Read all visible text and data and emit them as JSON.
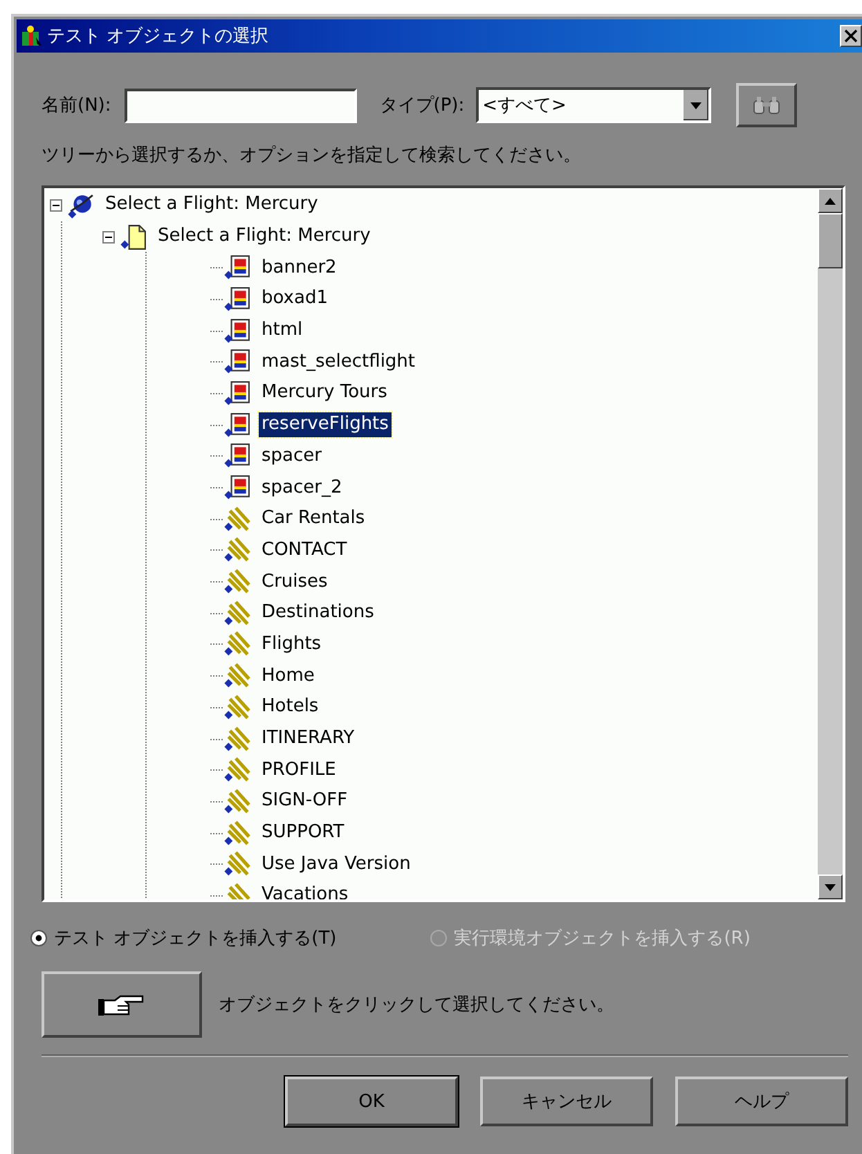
{
  "window": {
    "title": "テスト オブジェクトの選択"
  },
  "name_field": {
    "label": "名前(N):"
  },
  "type_field": {
    "label": "タイプ(P):",
    "value": "<すべて>"
  },
  "hint": "ツリーから選択するか、オプションを指定して検索してください。",
  "tree": [
    {
      "label": "Select a Flight: Mercury",
      "kind": "browser",
      "expanded": true,
      "selected": false,
      "children": [
        {
          "label": "Select a Flight: Mercury",
          "kind": "page",
          "expanded": true,
          "selected": false,
          "children": [
            {
              "label": "banner2",
              "kind": "image",
              "selected": false
            },
            {
              "label": "boxad1",
              "kind": "image",
              "selected": false
            },
            {
              "label": "html",
              "kind": "image",
              "selected": false
            },
            {
              "label": "mast_selectflight",
              "kind": "image",
              "selected": false
            },
            {
              "label": "Mercury Tours",
              "kind": "image",
              "selected": false
            },
            {
              "label": "reserveFlights",
              "kind": "image",
              "selected": true
            },
            {
              "label": "spacer",
              "kind": "image",
              "selected": false
            },
            {
              "label": "spacer_2",
              "kind": "image",
              "selected": false
            },
            {
              "label": "Car Rentals",
              "kind": "link",
              "selected": false
            },
            {
              "label": "CONTACT",
              "kind": "link",
              "selected": false
            },
            {
              "label": "Cruises",
              "kind": "link",
              "selected": false
            },
            {
              "label": "Destinations",
              "kind": "link",
              "selected": false
            },
            {
              "label": "Flights",
              "kind": "link",
              "selected": false
            },
            {
              "label": "Home",
              "kind": "link",
              "selected": false
            },
            {
              "label": "Hotels",
              "kind": "link",
              "selected": false
            },
            {
              "label": "ITINERARY",
              "kind": "link",
              "selected": false
            },
            {
              "label": "PROFILE",
              "kind": "link",
              "selected": false
            },
            {
              "label": "SIGN-OFF",
              "kind": "link",
              "selected": false
            },
            {
              "label": "SUPPORT",
              "kind": "link",
              "selected": false
            },
            {
              "label": "Use Java Version",
              "kind": "link",
              "selected": false
            },
            {
              "label": "Vacations",
              "kind": "link",
              "selected": false
            }
          ]
        }
      ]
    }
  ],
  "insert_options": [
    {
      "label": "テスト オブジェクトを挿入する(T)",
      "selected": true,
      "disabled": false
    },
    {
      "label": "実行環境オブジェクトを挿入する(R)",
      "selected": false,
      "disabled": true
    }
  ],
  "pointer_hint": "オブジェクトをクリックして選択してください。",
  "buttons": [
    "OK",
    "キャンセル",
    "ヘルプ"
  ]
}
